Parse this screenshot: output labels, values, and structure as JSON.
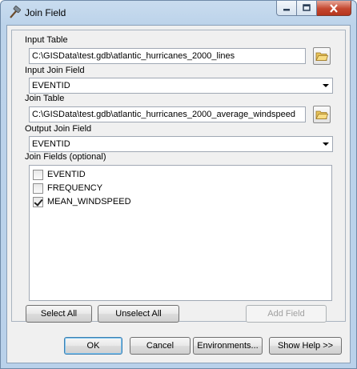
{
  "window": {
    "title": "Join Field"
  },
  "colors": {
    "title_bar": "#bcd3ea",
    "close_button": "#c4472f"
  },
  "form": {
    "input_table": {
      "label": "Input Table",
      "value": "C:\\GISData\\test.gdb\\atlantic_hurricanes_2000_lines"
    },
    "input_join_field": {
      "label": "Input Join Field",
      "value": "EVENTID"
    },
    "join_table": {
      "label": "Join Table",
      "value": "C:\\GISData\\test.gdb\\atlantic_hurricanes_2000_average_windspeed"
    },
    "output_join_field": {
      "label": "Output Join Field",
      "value": "EVENTID"
    },
    "join_fields": {
      "label": "Join Fields (optional)",
      "items": [
        {
          "label": "EVENTID",
          "checked": false
        },
        {
          "label": "FREQUENCY",
          "checked": false
        },
        {
          "label": "MEAN_WINDSPEED",
          "checked": true
        }
      ]
    }
  },
  "list_buttons": {
    "select_all": "Select All",
    "unselect_all": "Unselect All",
    "add_field": "Add Field"
  },
  "footer": {
    "ok": "OK",
    "cancel": "Cancel",
    "environments": "Environments...",
    "show_help": "Show Help >>"
  }
}
